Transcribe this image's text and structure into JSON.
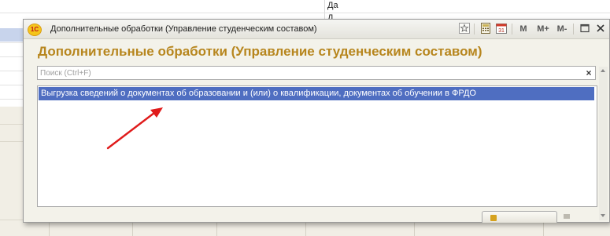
{
  "background": {
    "cells": [
      "Да",
      "Д"
    ]
  },
  "window": {
    "app_logo": "1С",
    "title": "Дополнительные обработки (Управление студенческим составом)",
    "toolbar": {
      "m_label": "M",
      "m_plus_label": "M+",
      "m_minus_label": "M-",
      "calendar_day": "31"
    },
    "heading": "Дополнительные обработки (Управление студенческим составом)",
    "search": {
      "placeholder": "Поиск (Ctrl+F)",
      "value": "",
      "clear_label": "×"
    },
    "list": {
      "items": [
        "Выгрузка сведений о документах об образовании и (или) о квалификации, документах об обучении в ФРДО"
      ]
    }
  },
  "colors": {
    "accent_heading": "#b7861e",
    "selection": "#4f6ec1",
    "annotation_arrow": "#e01b1b"
  },
  "icons": [
    "app-logo-icon",
    "favorite-icon",
    "calculator-icon",
    "calendar-icon",
    "maximize-icon",
    "close-icon",
    "annotation-arrow"
  ]
}
